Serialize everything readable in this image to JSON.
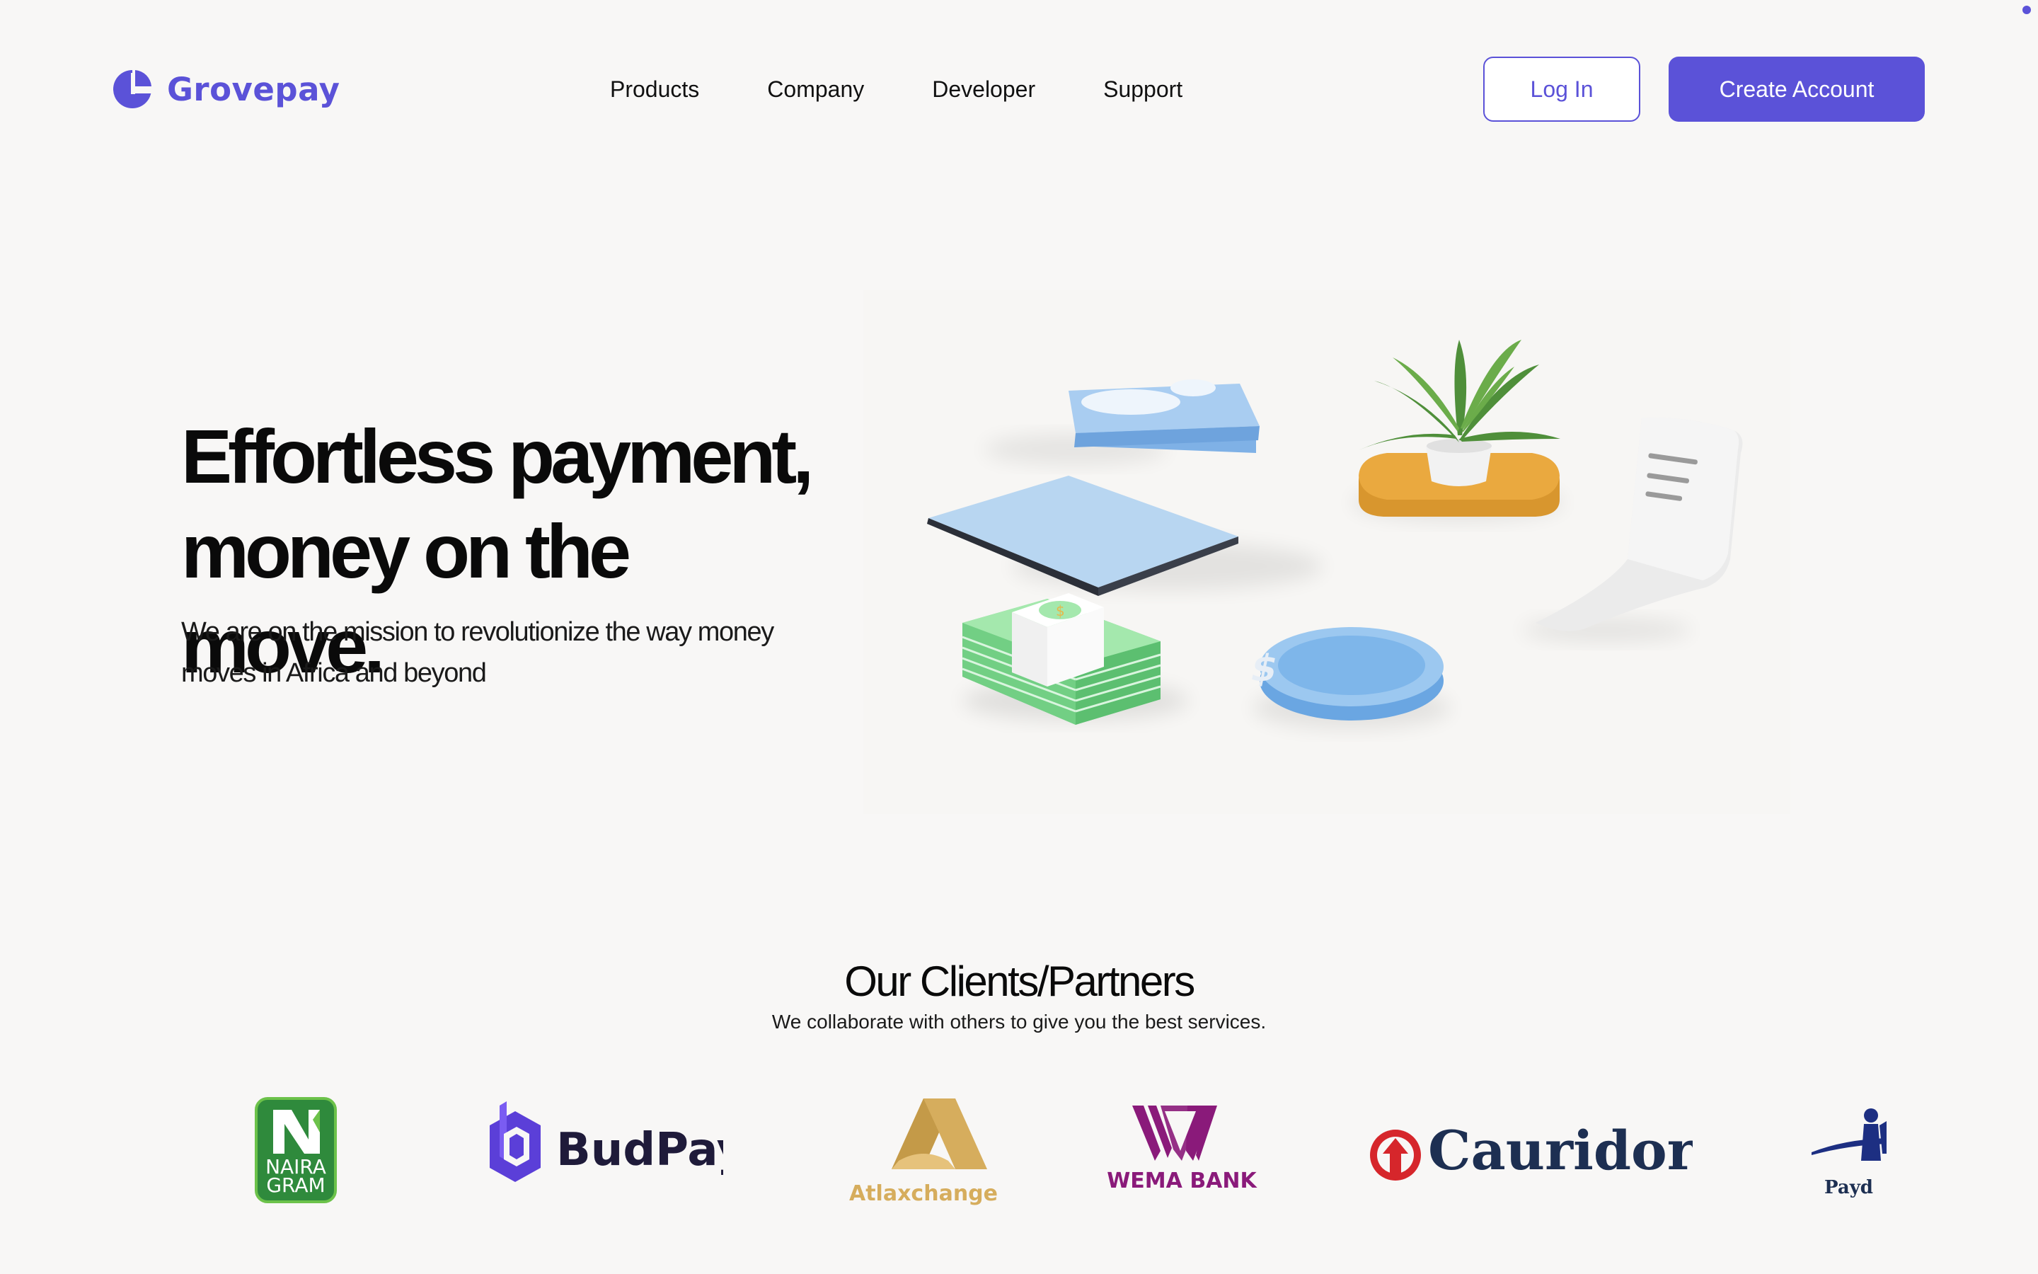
{
  "brand": {
    "name": "Grovepay",
    "color": "#5b52d8"
  },
  "nav": {
    "items": [
      "Products",
      "Company",
      "Developer",
      "Support"
    ]
  },
  "auth": {
    "login_label": "Log In",
    "create_label": "Create Account"
  },
  "hero": {
    "title_line1": "Effortless payment,",
    "title_line2": "money on the move.",
    "subtitle_line1": "We are on the mission to revolutionize the way money",
    "subtitle_line2": "moves in Africa and beyond"
  },
  "partners": {
    "title": "Our Clients/Partners",
    "subtitle": "We collaborate with others to give you the best services.",
    "logos": [
      {
        "name": "NAIRAGRAM",
        "line1": "NAIRA",
        "line2": "GRAM",
        "icon": "nairagram-logo"
      },
      {
        "name": "BudPay",
        "icon": "budpay-logo"
      },
      {
        "name": "Atlaxchange",
        "icon": "atlaxchange-logo"
      },
      {
        "name": "WEMA BANK",
        "icon": "wema-bank-logo"
      },
      {
        "name": "Cauridor",
        "icon": "cauridor-logo"
      },
      {
        "name": "Payd",
        "icon": "payday-logo"
      }
    ]
  }
}
